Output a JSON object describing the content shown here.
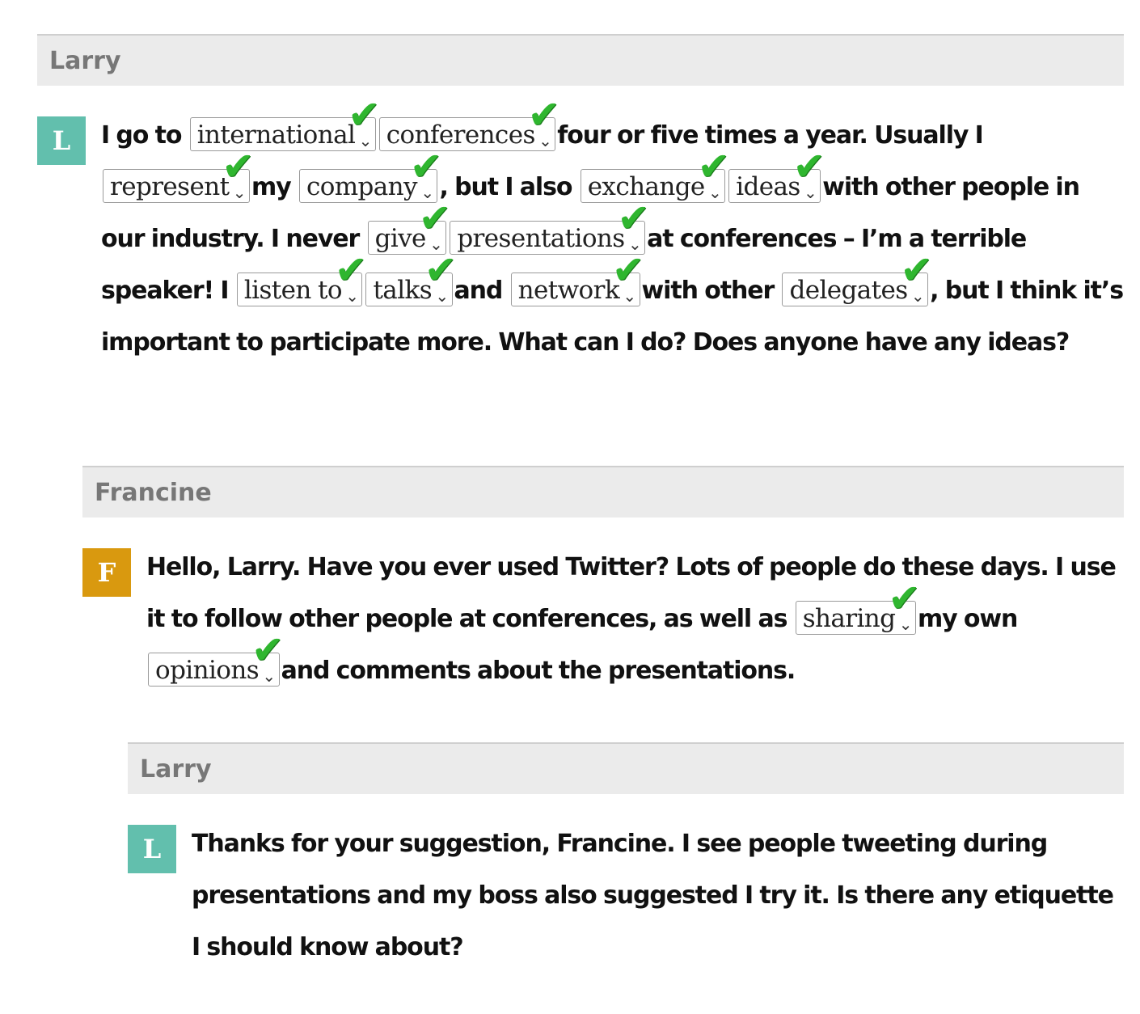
{
  "colors": {
    "avatar_teal": "#62bfad",
    "avatar_gold": "#d9990f",
    "check_green": "#2fb62f"
  },
  "icons": {
    "dropdown": "chevron-down-icon",
    "correct": "checkmark-icon"
  },
  "posts": [
    {
      "author": "Larry",
      "initial": "L",
      "segments": [
        {
          "t": "I go to "
        },
        {
          "gap": "international"
        },
        {
          "gap": "conferences"
        },
        {
          "t": "four or five times a year. Usually I "
        },
        {
          "gap": "represent"
        },
        {
          "t": "my "
        },
        {
          "gap": "company"
        },
        {
          "t": ", but I also "
        },
        {
          "gap": "exchange"
        },
        {
          "gap": "ideas"
        },
        {
          "t": "with other people in our industry. I never "
        },
        {
          "gap": "give"
        },
        {
          "gap": "presentations"
        },
        {
          "t": "at conferences – I’m a terrible speaker! I "
        },
        {
          "gap": "listen to"
        },
        {
          "gap": "talks"
        },
        {
          "t": "and "
        },
        {
          "gap": "network"
        },
        {
          "t": "with other "
        },
        {
          "gap": "delegates"
        },
        {
          "t": ", but I think it’s important to participate more. What can I do? Does anyone have any ideas?"
        }
      ]
    },
    {
      "author": "Francine",
      "initial": "F",
      "segments": [
        {
          "t": "Hello, Larry. Have you ever used Twitter? Lots of people do these days. I use it to follow other people at conferences, as well as "
        },
        {
          "gap": "sharing"
        },
        {
          "t": "my own "
        },
        {
          "gap": "opinions"
        },
        {
          "t": "and comments about the presentations."
        }
      ]
    },
    {
      "author": "Larry",
      "initial": "L",
      "segments": [
        {
          "t": "Thanks for your suggestion, Francine. I see people tweeting during presentations and my boss also suggested I try it. Is there any etiquette I should know about?"
        }
      ]
    }
  ]
}
